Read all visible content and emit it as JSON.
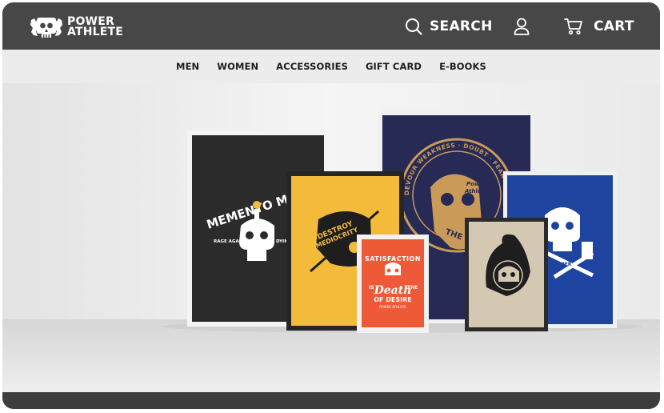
{
  "brand": {
    "line1": "POWER",
    "line2": "ATHLETE"
  },
  "header": {
    "search_label": "SEARCH",
    "cart_label": "CART"
  },
  "nav": {
    "items": [
      "MEN",
      "WOMEN",
      "ACCESSORIES",
      "GIFT CARD",
      "E-BOOKS"
    ]
  },
  "hero": {
    "poster_memento": {
      "title": "MEMENTO MORI",
      "subtitle": "RAGE AGAINST THE",
      "subtitle2": "DYING LIGHT"
    },
    "poster_destroy": {
      "line1": "DESTROY",
      "line2": "MEDIOCRITY"
    },
    "poster_satisfaction": {
      "line1": "SATISFACTION",
      "line2": "IS",
      "line3": "THE",
      "line4": "Death",
      "line5": "OF DESIRE",
      "line6": "POWER ATHLETE"
    },
    "poster_devour": {
      "ring": "DEVOUR WEAKNESS · DOUBT · FEAR & FEEBLE EXC",
      "center1": "Power",
      "center2": "Athlete",
      "jaw": "THE WEAK"
    },
    "poster_hammer": {
      "text": "HAMMER"
    }
  },
  "colors": {
    "topbar": "#474747",
    "navbar": "#ececec",
    "poster_black": "#2b2b2b",
    "poster_yellow": "#f4bb3a",
    "poster_orange": "#ee5a38",
    "poster_navy": "#262a55",
    "poster_blue": "#1f44a0",
    "poster_tan": "#d5c8b3",
    "gold": "#c99a58"
  },
  "icons": [
    "skull-logo-icon",
    "search-icon",
    "user-icon",
    "cart-icon"
  ]
}
